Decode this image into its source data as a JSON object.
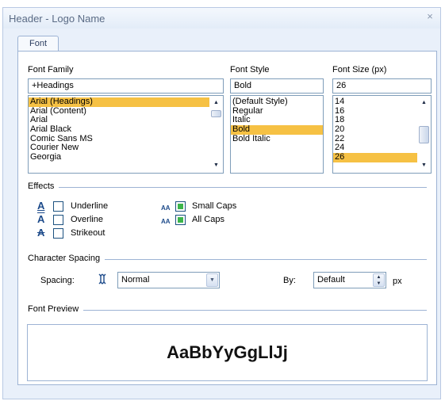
{
  "dialog": {
    "title": "Header - Logo Name",
    "close_glyph": "×",
    "tab_label": "Font"
  },
  "font_family": {
    "label": "Font Family",
    "value": "+Headings",
    "items": [
      "Arial (Headings)",
      "Arial (Content)",
      "Arial",
      "Arial Black",
      "Comic Sans MS",
      "Courier New",
      "Georgia"
    ],
    "selected_index": 0
  },
  "font_style": {
    "label": "Font Style",
    "value": "Bold",
    "items": [
      "(Default Style)",
      "Regular",
      "Italic",
      "Bold",
      "Bold Italic"
    ],
    "selected_index": 3
  },
  "font_size": {
    "label": "Font Size (px)",
    "value": "26",
    "items": [
      "14",
      "16",
      "18",
      "20",
      "22",
      "24",
      "26"
    ],
    "selected_index": 6
  },
  "effects": {
    "title": "Effects",
    "underline": {
      "label": "Underline",
      "icon_glyph": "A",
      "checked": false
    },
    "overline": {
      "label": "Overline",
      "icon_glyph": "A",
      "checked": false
    },
    "strikeout": {
      "label": "Strikeout",
      "icon_glyph": "A",
      "checked": false
    },
    "small_caps": {
      "label": "Small Caps",
      "icon_glyph": "AA",
      "checked": true
    },
    "all_caps": {
      "label": "All Caps",
      "icon_glyph": "AA",
      "checked": true
    }
  },
  "spacing": {
    "title": "Character Spacing",
    "spacing_label": "Spacing:",
    "spacing_value": "Normal",
    "by_label": "By:",
    "by_value": "Default",
    "unit": "px"
  },
  "preview": {
    "title": "Font Preview",
    "text": "AaBbYyGgLlJj"
  },
  "colors": {
    "selection": "#f6c144",
    "border": "#7f9db9",
    "checked": "#3cb44b"
  }
}
